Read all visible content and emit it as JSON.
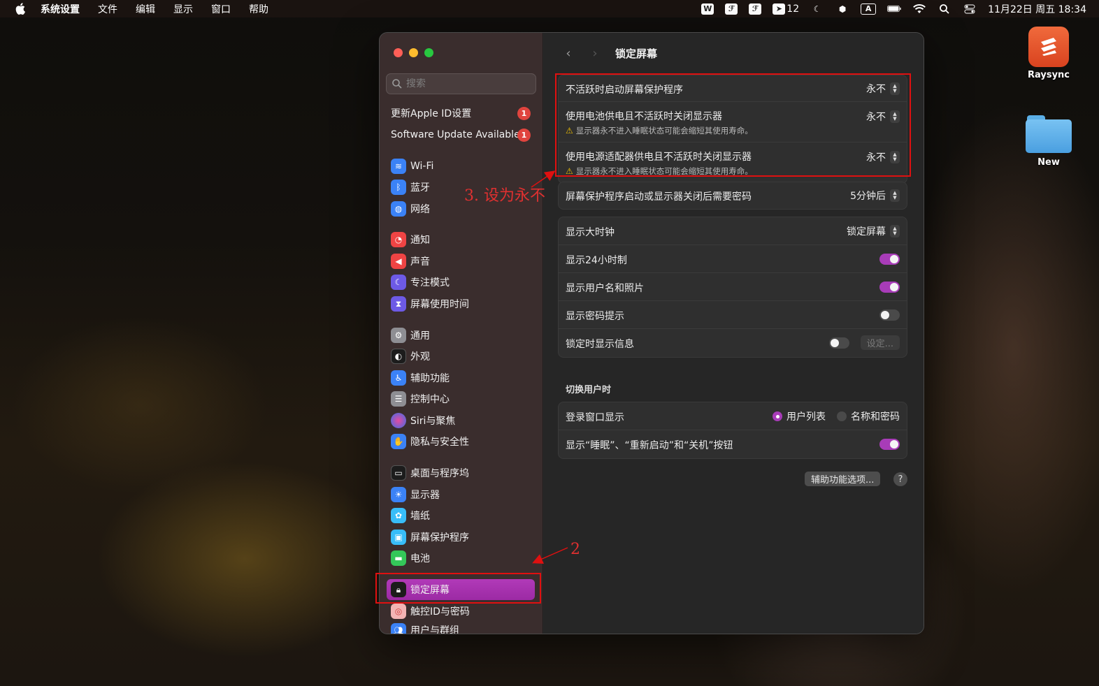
{
  "menubar": {
    "app_name": "系统设置",
    "menus": [
      "文件",
      "编辑",
      "显示",
      "窗口",
      "帮助"
    ],
    "status_icons": [
      "wps-icon",
      "pdf-icon",
      "pdf-icon-2",
      "cursor-icon",
      "moon-icon",
      "bookmark-icon",
      "input-a-icon",
      "battery-icon",
      "wifi-icon",
      "search-icon",
      "control-center-icon"
    ],
    "cursor_count": "12",
    "input_letter": "A",
    "datetime": "11月22日 周五  18:34"
  },
  "desktop": {
    "icons": [
      {
        "label": "Raysync"
      },
      {
        "label": "New"
      }
    ]
  },
  "window": {
    "search_placeholder": "搜索",
    "updates": [
      {
        "label": "更新Apple ID设置",
        "badge": "1"
      },
      {
        "label": "Software Update Available",
        "badge": "1"
      }
    ],
    "sidebar": [
      {
        "label": "Wi-Fi",
        "icon": "wifi-icon",
        "color": "#3b82f6"
      },
      {
        "label": "蓝牙",
        "icon": "bluetooth-icon",
        "color": "#3b82f6"
      },
      {
        "label": "网络",
        "icon": "globe-icon",
        "color": "#3b82f6"
      },
      {
        "label": "通知",
        "icon": "bell-icon",
        "color": "#ef4444"
      },
      {
        "label": "声音",
        "icon": "speaker-icon",
        "color": "#ef4444"
      },
      {
        "label": "专注模式",
        "icon": "moon-icon",
        "color": "#6d5ae6"
      },
      {
        "label": "屏幕使用时间",
        "icon": "hourglass-icon",
        "color": "#6d5ae6"
      },
      {
        "label": "通用",
        "icon": "gear-icon",
        "color": "#8e8e93"
      },
      {
        "label": "外观",
        "icon": "appearance-icon",
        "color": "#1c1c1c"
      },
      {
        "label": "辅助功能",
        "icon": "accessibility-icon",
        "color": "#3b82f6"
      },
      {
        "label": "控制中心",
        "icon": "control-center-icon",
        "color": "#8e8e93"
      },
      {
        "label": "Siri与聚焦",
        "icon": "siri-icon",
        "color": "#7b3fe4"
      },
      {
        "label": "隐私与安全性",
        "icon": "hand-icon",
        "color": "#3b82f6"
      },
      {
        "label": "桌面与程序坞",
        "icon": "dock-icon",
        "color": "#1c1c1c"
      },
      {
        "label": "显示器",
        "icon": "sun-icon",
        "color": "#3b82f6"
      },
      {
        "label": "墙纸",
        "icon": "flower-icon",
        "color": "#38bdf8"
      },
      {
        "label": "屏幕保护程序",
        "icon": "screensaver-icon",
        "color": "#38bdf8"
      },
      {
        "label": "电池",
        "icon": "battery-icon",
        "color": "#34c759"
      },
      {
        "label": "锁定屏幕",
        "icon": "lock-icon",
        "color": "#1c1c1c",
        "selected": true
      },
      {
        "label": "触控ID与密码",
        "icon": "fingerprint-icon",
        "color": "#f3b4b4"
      },
      {
        "label": "用户与群组",
        "icon": "users-icon",
        "color": "#3b82f6"
      }
    ],
    "title": "锁定屏幕",
    "group1": [
      {
        "label": "不活跃时启动屏幕保护程序",
        "value": "永不"
      },
      {
        "label": "使用电池供电且不活跃时关闭显示器",
        "value": "永不",
        "warning": "显示器永不进入睡眠状态可能会缩短其使用寿命。"
      },
      {
        "label": "使用电源适配器供电且不活跃时关闭显示器",
        "value": "永不",
        "warning": "显示器永不进入睡眠状态可能会缩短其使用寿命。"
      }
    ],
    "group2": {
      "label": "屏幕保护程序启动或显示器关闭后需要密码",
      "value": "5分钟后"
    },
    "group3": {
      "clock": {
        "label": "显示大时钟",
        "value": "锁定屏幕"
      },
      "toggles": [
        {
          "label": "显示24小时制",
          "on": true
        },
        {
          "label": "显示用户名和照片",
          "on": true
        },
        {
          "label": "显示密码提示",
          "on": false
        }
      ],
      "message": {
        "label": "锁定时显示信息",
        "on": false,
        "button": "设定..."
      }
    },
    "switch_section": "切换用户时",
    "group4": {
      "login": {
        "label": "登录窗口显示",
        "options": [
          "用户列表",
          "名称和密码"
        ],
        "selected": 0
      },
      "buttons_toggle": {
        "label": "显示“睡眠”、“重新启动”和“关机”按钮",
        "on": true
      }
    },
    "accessibility_button": "辅助功能选项...",
    "help": "?"
  },
  "annotations": {
    "step3": "3. 设为永不",
    "step2": "2",
    "color": "#e01010"
  }
}
